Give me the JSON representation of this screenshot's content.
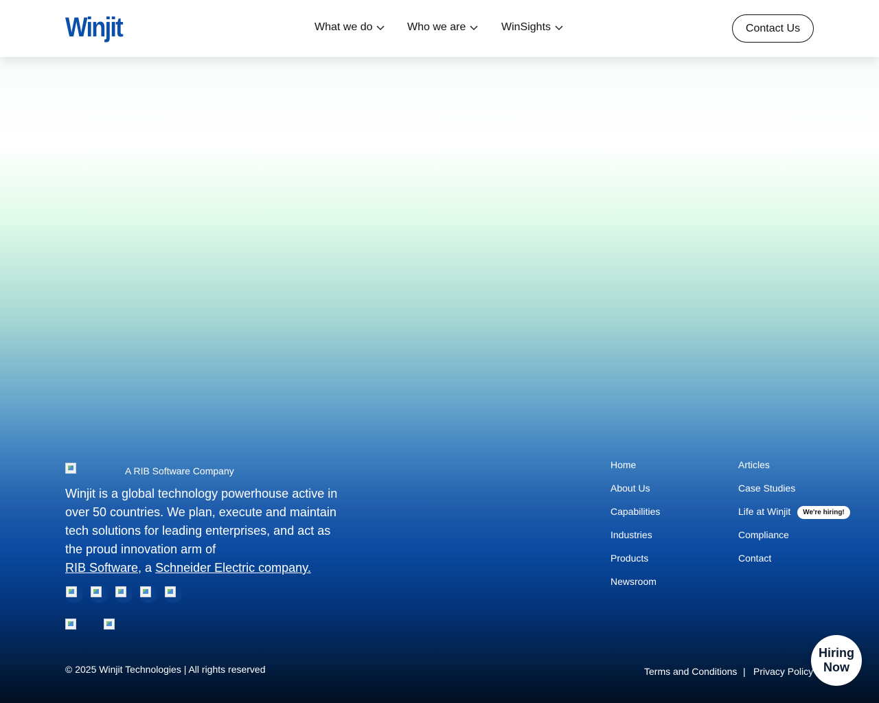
{
  "header": {
    "logo_text": "Winjit",
    "nav": [
      {
        "label": "What we do"
      },
      {
        "label": "Who we are"
      },
      {
        "label": "WinSights"
      }
    ],
    "contact_label": "Contact Us"
  },
  "footer": {
    "rib_label": "A RIB Software Company",
    "about_text": "Winjit is a global technology powerhouse active in over 50 countries. We plan, execute and maintain tech solutions for leading enterprises, and act as the proud innovation arm of",
    "rib_link": "RIB Software",
    "separator": ", a ",
    "schneider_link": "Schneider Electric company.",
    "links_col1": [
      "Home",
      "About Us",
      "Capabilities",
      "Industries",
      "Products",
      "Newsroom"
    ],
    "links_col2": [
      "Articles",
      "Case Studies",
      "Life at Winjit",
      "Compliance",
      "Contact"
    ],
    "hiring_badge": "We're hiring!",
    "copyright": "© 2025 Winjit Technologies | All rights reserved",
    "terms": "Terms and Conditions",
    "legal_separator": "|",
    "privacy": "Privacy Policy"
  },
  "hiring_button": {
    "line1": "Hiring",
    "line2": "Now"
  },
  "colors": {
    "brand_blue": "#0a4fa8",
    "footer_dark": "#020f21"
  },
  "icons": [
    "chevron-down-icon",
    "social-icon",
    "badge-image"
  ]
}
